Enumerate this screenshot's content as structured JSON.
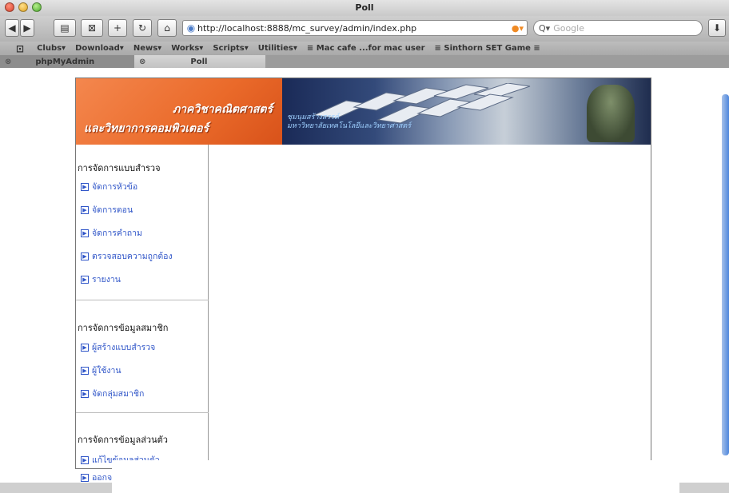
{
  "window": {
    "title": "Poll"
  },
  "toolbar": {
    "url": "http://localhost:8888/mc_survey/admin/index.php",
    "search_placeholder": "Google"
  },
  "bookmarks": [
    "Clubs▾",
    "Download▾",
    "News▾",
    "Works▾",
    "Scripts▾",
    "Utilities▾",
    "≡ Mac cafe ...for mac user",
    "≡ Sinthorn SET Game ≡"
  ],
  "tabs": [
    {
      "label": "phpMyAdmin",
      "active": false
    },
    {
      "label": "Poll",
      "active": true
    }
  ],
  "banner": {
    "line1": "ภาควิชาคณิตศาสตร์",
    "line2": "และวิทยาการคอมพิวเตอร์",
    "caption1": "ชุมนุมสร้างสรรค์",
    "caption2": "มหาวิทยาลัยเทคโนโลยีและวิทยาศาสตร์"
  },
  "sidebar": {
    "sections": [
      {
        "heading": "การจัดการแบบสำรวจ",
        "items": [
          "จัดการหัวข้อ",
          "จัดการตอน",
          "จัดการคำถาม",
          "ตรวจสอบความถูกต้อง",
          "รายงาน"
        ]
      },
      {
        "heading": "การจัดการข้อมูลสมาชิก",
        "items": [
          "ผู้สร้างแบบสำรวจ",
          "ผู้ใช้งาน",
          "จัดกลุ่มสมาชิก"
        ]
      },
      {
        "heading": "การจัดการข้อมูลส่วนตัว",
        "items": [
          "แก้ไขข้อมูลส่วนตัว",
          "ออกจ"
        ]
      }
    ]
  },
  "colors": {
    "link": "#2f55c8",
    "banner_orange": "#ea6a2a"
  }
}
